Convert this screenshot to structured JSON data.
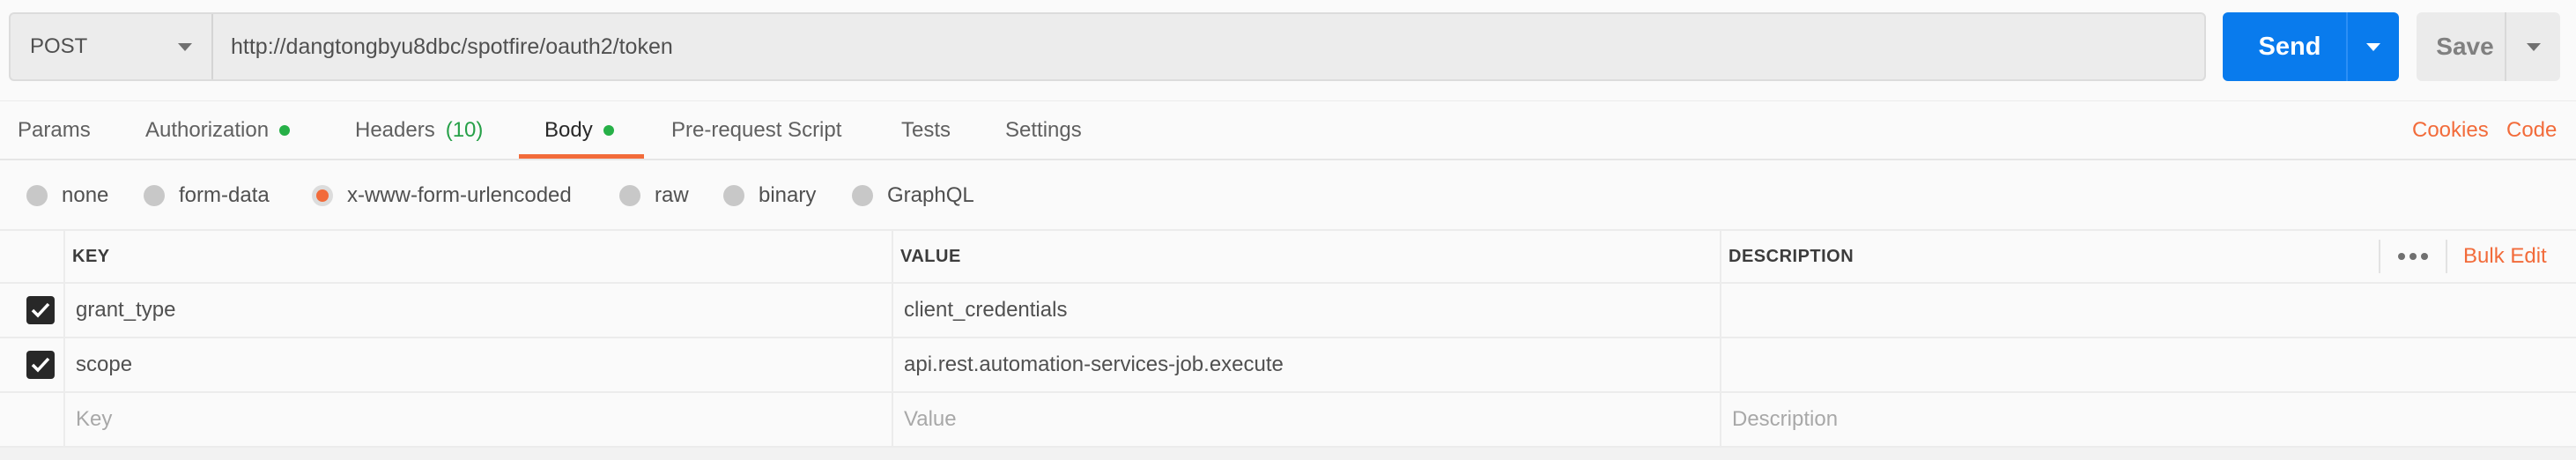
{
  "request": {
    "method": "POST",
    "url": "http://dangtongbyu8dbc/spotfire/oauth2/token",
    "send_label": "Send",
    "save_label": "Save"
  },
  "tabs": [
    {
      "label": "Params"
    },
    {
      "label": "Authorization",
      "dot": true
    },
    {
      "label": "Headers",
      "count": "(10)"
    },
    {
      "label": "Body",
      "dot": true,
      "active": true
    },
    {
      "label": "Pre-request Script"
    },
    {
      "label": "Tests"
    },
    {
      "label": "Settings"
    }
  ],
  "links": {
    "cookies": "Cookies",
    "code": "Code"
  },
  "body_types": [
    {
      "label": "none"
    },
    {
      "label": "form-data"
    },
    {
      "label": "x-www-form-urlencoded",
      "selected": true
    },
    {
      "label": "raw"
    },
    {
      "label": "binary"
    },
    {
      "label": "GraphQL"
    }
  ],
  "table": {
    "headers": {
      "key": "KEY",
      "value": "VALUE",
      "description": "DESCRIPTION"
    },
    "bulk_edit": "Bulk Edit",
    "rows": [
      {
        "checked": true,
        "key": "grant_type",
        "value": "client_credentials",
        "description": ""
      },
      {
        "checked": true,
        "key": "scope",
        "value": "api.rest.automation-services-job.execute",
        "description": ""
      }
    ],
    "placeholders": {
      "key": "Key",
      "value": "Value",
      "description": "Description"
    }
  },
  "colors": {
    "accent": "#f26b3a",
    "send_button": "#097bed",
    "status_dot": "#26b047"
  }
}
